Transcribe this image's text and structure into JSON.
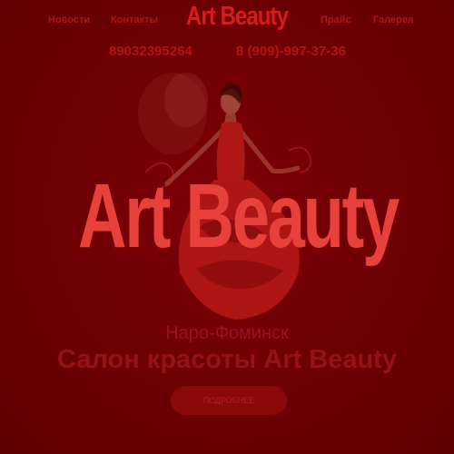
{
  "colors": {
    "background": "#6e0000",
    "logo": "#e8403a",
    "nav_text": "#b01515",
    "button_bg": "#890808"
  },
  "nav": {
    "news_label": "Новости",
    "contacts_label": "Контакты",
    "logo_text": "Art Beauty",
    "prices_label": "Прайс",
    "gallery_label": "Галерея"
  },
  "phones": {
    "phone1": "89032395264",
    "phone2": "8 (909)-997-37-36"
  },
  "hero": {
    "logo_text": "Art Beauty",
    "city": "Наро-Фоминск",
    "title": "Салон красоты Art Beauty",
    "button_label": "ПОДРОБНЕЕ"
  },
  "icons": [
    "dancer-illustration"
  ]
}
